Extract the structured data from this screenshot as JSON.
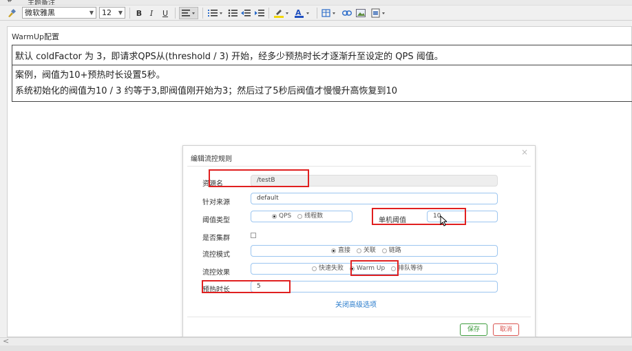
{
  "top_strip": {
    "icon": "#",
    "text": "主题备注"
  },
  "toolbar": {
    "font_name": "微软雅黑",
    "font_size": "12",
    "bold": "B",
    "italic": "I",
    "underline": "U",
    "highlight_color": "#f2d600",
    "font_color": "#1f4fbf"
  },
  "editor": {
    "title": "WarmUp配置",
    "row1": "默认 coldFactor 为 3，即请求QPS从(threshold / 3) 开始，经多少预热时长才逐渐升至设定的 QPS 阈值。",
    "row2_line1": "案例，阀值为10+预热时长设置5秒。",
    "row2_line2": "系统初始化的阀值为10 / 3 约等于3,即阀值刚开始为3；然后过了5秒后阀值才慢慢升高恢复到10"
  },
  "dialog": {
    "title": "编辑流控规则",
    "close": "×",
    "resource_label": "资源名",
    "resource_value": "/testB",
    "source_label": "针对来源",
    "source_value": "default",
    "threshold_type_label": "阈值类型",
    "threshold_type_options": [
      "QPS",
      "线程数"
    ],
    "threshold_label": "单机阈值",
    "threshold_value": "10",
    "cluster_label": "是否集群",
    "mode_label": "流控模式",
    "mode_options": [
      "直接",
      "关联",
      "链路"
    ],
    "effect_label": "流控效果",
    "effect_options": [
      "快速失败",
      "Warm Up",
      "排队等待"
    ],
    "warmup_label": "预热时长",
    "warmup_value": "5",
    "advanced_link": "关闭高级选项",
    "save": "保存",
    "cancel": "取消"
  },
  "scroll": {
    "left_arrow": "<"
  },
  "colors": {
    "highlight_red": "#e01f1f",
    "save_green": "#3c9b3c",
    "cancel_red": "#d9534f",
    "link_blue": "#2a7ccc"
  }
}
